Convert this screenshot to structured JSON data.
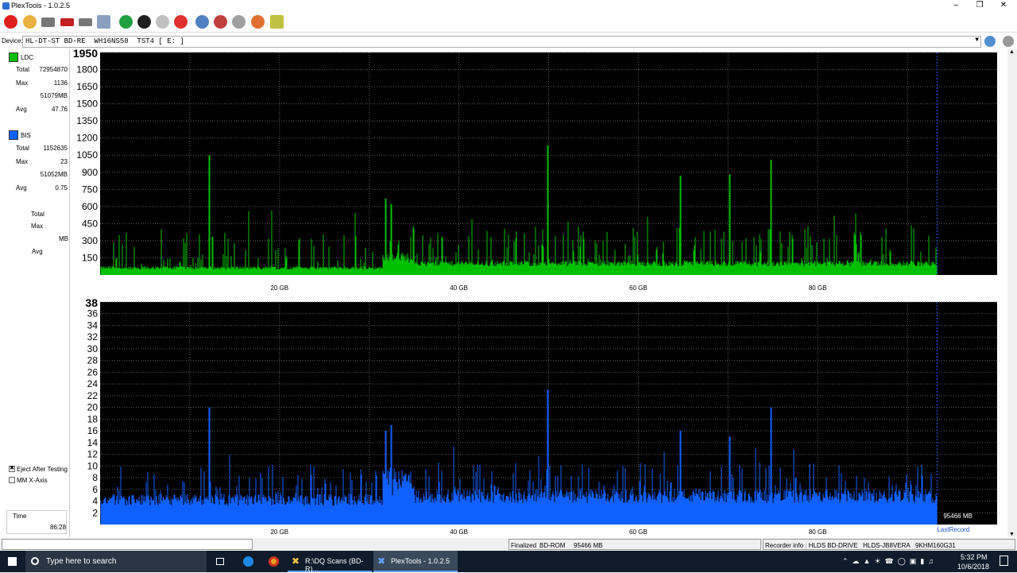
{
  "window": {
    "title": "PlexTools - 1.0.2.5"
  },
  "device": {
    "label": "Device:",
    "value": "HL-DT-ST BD-RE  WH16NS58  TST4 [ E: ]"
  },
  "ldc": {
    "label": "LDC",
    "total_label": "Total",
    "total": "72954870",
    "max_label": "Max",
    "max": "1136",
    "max_pos": "51079MB",
    "avg_label": "Avg",
    "avg": "47.76",
    "color": "#00c000"
  },
  "bis": {
    "label": "BIS",
    "total_label": "Total",
    "total": "1152635",
    "max_label": "Max",
    "max": "23",
    "max_pos": "51052MB",
    "avg_label": "Avg",
    "avg": "0.75",
    "color": "#1060ff"
  },
  "jitter": {
    "total_label": "Total",
    "max_label": "Max",
    "mb_label": "MB",
    "avg_label": "Avg"
  },
  "options": {
    "eject": "Eject After Testing",
    "mm_xaxis": "MM X-Axis"
  },
  "time": {
    "label": "Time",
    "value": "86:28"
  },
  "chart_data": [
    {
      "type": "area",
      "title": "",
      "ylim": [
        0,
        1950
      ],
      "y_ticks": [
        "150",
        "300",
        "450",
        "600",
        "750",
        "900",
        "1050",
        "1200",
        "1350",
        "1500",
        "1650",
        "1800",
        "1950"
      ],
      "x_ticks": [
        "20 GB",
        "40 GB",
        "60 GB",
        "80 GB"
      ],
      "xlim_gb": [
        0,
        100
      ],
      "last_record_gb": 93.3,
      "series": [
        {
          "name": "LDC",
          "color": "#00c000",
          "base": 60,
          "max": 1136,
          "max_at_gb": 49.9
        }
      ]
    },
    {
      "type": "area",
      "title": "",
      "ylim": [
        0,
        38
      ],
      "y_ticks": [
        "2",
        "4",
        "6",
        "8",
        "10",
        "12",
        "14",
        "16",
        "18",
        "20",
        "22",
        "24",
        "26",
        "28",
        "30",
        "32",
        "34",
        "36",
        "38"
      ],
      "x_ticks": [
        "20 GB",
        "40 GB",
        "60 GB",
        "80 GB"
      ],
      "xlim_gb": [
        0,
        100
      ],
      "last_record_gb": 93.3,
      "series": [
        {
          "name": "BIS",
          "color": "#1060ff",
          "base": 4,
          "max": 23,
          "max_at_gb": 49.9
        }
      ],
      "end_label": "95466 MB",
      "last_record_label": "LastRecord"
    }
  ],
  "status": {
    "state": "Finalized",
    "type": "BD-ROM",
    "size": "95466 MB",
    "recorder": "Recorder info : HLDS BD-DRIVE   HLDS-JB8VERA   9KHM160G31"
  },
  "taskbar": {
    "search": "Type here to search",
    "app1": "R:\\DQ Scans (BD-R)...",
    "app2": "PlexTools - 1.0.2.5",
    "time": "5:32 PM",
    "date": "10/6/2018"
  }
}
